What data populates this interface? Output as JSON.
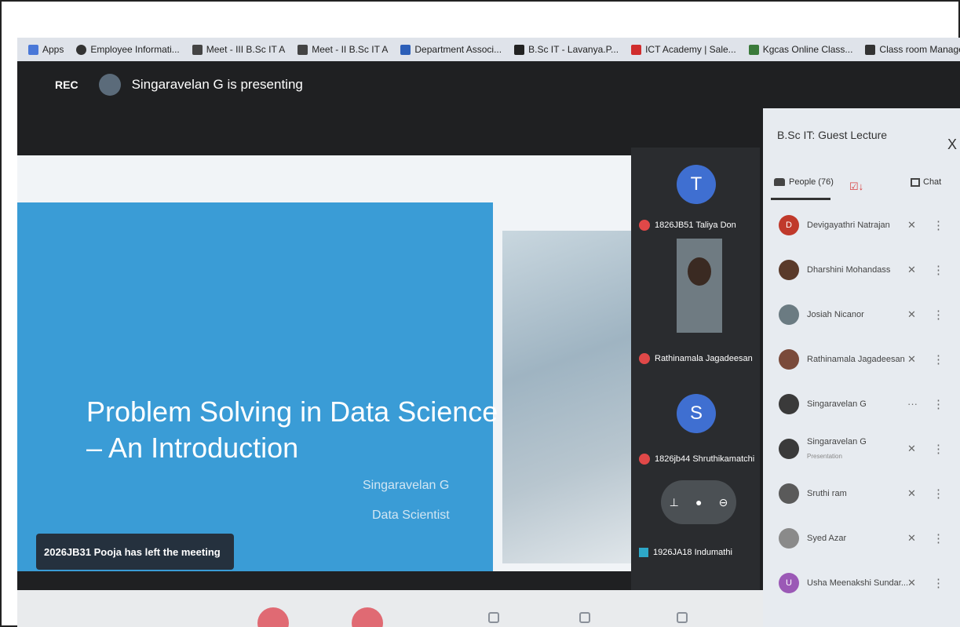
{
  "bookmarks": [
    {
      "label": "Apps",
      "color": "#4a78d8"
    },
    {
      "label": "Employee Informati...",
      "color": "#333333"
    },
    {
      "label": "Meet - III B.Sc IT A",
      "color": "#444444"
    },
    {
      "label": "Meet - II B.Sc IT A",
      "color": "#444444"
    },
    {
      "label": "Department Associ...",
      "color": "#2d5fb8"
    },
    {
      "label": "B.Sc IT - Lavanya.P...",
      "color": "#222222"
    },
    {
      "label": "ICT Academy | Sale...",
      "color": "#d02d2d"
    },
    {
      "label": "Kgcas Online Class...",
      "color": "#3a7a3a"
    },
    {
      "label": "Class room Manage...",
      "color": "#333333"
    }
  ],
  "topbar": {
    "rec": "REC",
    "presenting": "Singaravelan G is presenting"
  },
  "slide": {
    "title_line1": "Problem Solving in Data Science",
    "title_line2": "– An Introduction",
    "author": "Singaravelan G",
    "role": "Data Scientist"
  },
  "toast": "2026JB31 Pooja has left the meeting",
  "tiles": [
    {
      "initial": "T",
      "label": "1826JB51 Taliya Don"
    },
    {
      "label": "Rathinamala Jagadeesan"
    },
    {
      "initial": "S",
      "label": "1826jb44 Shruthikamatchi"
    },
    {
      "label": "1926JA18 Indumathi"
    }
  ],
  "panel": {
    "title": "B.Sc IT: Guest Lecture",
    "close": "X",
    "people_tab": "People (76)",
    "chat_tab": "Chat",
    "participants": [
      {
        "name": "Devigayathri Natrajan",
        "initial": "D",
        "color": "#c0392b"
      },
      {
        "name": "Dharshini Mohandass",
        "initial": "",
        "color": "#5a3a2a"
      },
      {
        "name": "Josiah Nicanor",
        "initial": "",
        "color": "#6b7b82"
      },
      {
        "name": "Rathinamala Jagadeesan",
        "initial": "",
        "color": "#7a4a3a"
      },
      {
        "name": "Singaravelan G",
        "initial": "",
        "color": "#3a3a3a"
      },
      {
        "name": "Singaravelan G",
        "sub": "Presentation",
        "initial": "",
        "color": "#3a3a3a"
      },
      {
        "name": "Sruthi ram",
        "initial": "",
        "color": "#5a5a5a"
      },
      {
        "name": "Syed Azar",
        "initial": "",
        "color": "#8a8a8a"
      },
      {
        "name": "Usha Meenakshi Sundar...",
        "initial": "U",
        "color": "#9b59b6"
      }
    ]
  }
}
